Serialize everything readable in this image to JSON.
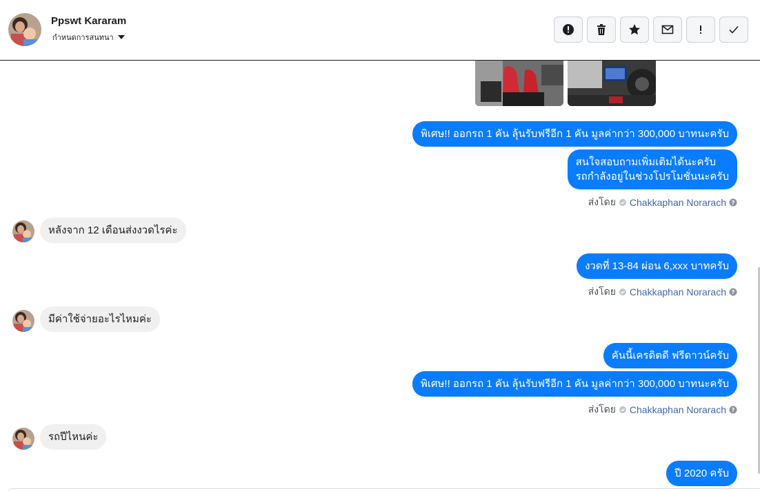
{
  "header": {
    "contact_name": "Ppswt Kararam",
    "conversation_label": "กำหนดการสนทนา"
  },
  "toolbar": {
    "buttons": [
      {
        "name": "report-spam-button",
        "icon": "alert-circle-icon"
      },
      {
        "name": "delete-button",
        "icon": "trash-icon"
      },
      {
        "name": "star-button",
        "icon": "star-icon"
      },
      {
        "name": "mark-unread-button",
        "icon": "envelope-icon"
      },
      {
        "name": "follow-up-button",
        "icon": "exclamation-icon"
      },
      {
        "name": "mark-done-button",
        "icon": "check-icon"
      }
    ]
  },
  "messages": [
    {
      "type": "out",
      "lines": [
        "พิเศษ!! ออกรถ 1 คัน ลุ้นรับฟรีอีก 1 คัน มูลค่ากว่า 300,000 บาทนะครับ"
      ]
    },
    {
      "type": "out",
      "lines": [
        "สนใจสอบถามเพิ่มเติมได้นะครับ",
        "รถกำลังอยู่ในช่วงโปรโมชั่นนะครับ"
      ]
    },
    {
      "type": "in",
      "lines": [
        "หลังจาก 12 เดือนส่งงวดไรค่ะ"
      ]
    },
    {
      "type": "out",
      "lines": [
        "งวดที่ 13-84 ผ่อน 6,xxx บาทครับ"
      ]
    },
    {
      "type": "in",
      "lines": [
        "มีค่าใช้จ่ายอะไรไหมค่ะ"
      ]
    },
    {
      "type": "out",
      "lines": [
        "คันนี้เครดิตดี ฟรีดาวน์ครับ"
      ]
    },
    {
      "type": "out",
      "lines": [
        "พิเศษ!! ออกรถ 1 คัน ลุ้นรับฟรีอีก 1 คัน มูลค่ากว่า 300,000 บาทนะครับ"
      ]
    },
    {
      "type": "in",
      "lines": [
        "รถปีไหนค่ะ"
      ]
    },
    {
      "type": "out",
      "lines": [
        "ปี 2020 ครับ"
      ]
    }
  ],
  "sent_by": {
    "prefix": "ส่งโดย",
    "agent": "Chakkaphan Norarach"
  },
  "colors": {
    "outgoing_bubble": "#0a7cff",
    "incoming_bubble": "#f0f0f0",
    "agent_link": "#4267b2"
  }
}
